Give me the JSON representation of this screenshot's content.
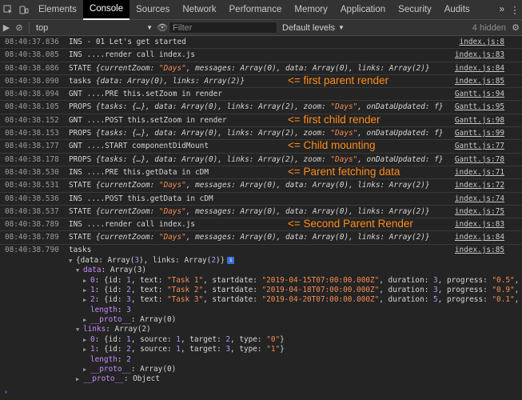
{
  "tabs": [
    "Elements",
    "Console",
    "Sources",
    "Network",
    "Performance",
    "Memory",
    "Application",
    "Security",
    "Audits"
  ],
  "toolbar": {
    "context": "top",
    "filter_placeholder": "Filter",
    "levels": "Default levels",
    "hidden": "4 hidden"
  },
  "logs": [
    {
      "ts": "08:40:37.836",
      "text": "INS - 01 Let's get started",
      "src": "index.js:8"
    },
    {
      "ts": "08:40:38.085",
      "text": "INS ....render call index.js",
      "src": "index.js:83"
    },
    {
      "ts": "08:40:38.086",
      "prefix": "STATE",
      "obj": "{currentZoom: \"Days\", messages: Array(0), data: Array(0), links: Array(2)}",
      "src": "index.js:84"
    },
    {
      "ts": "08:40:38.090",
      "text": "tasks",
      "obj": "{data: Array(0), links: Array(2)}",
      "src": "index.js:85",
      "ann": "<= first parent render"
    },
    {
      "ts": "08:40:38.094",
      "text": "GNT ....PRE this.setZoom in render",
      "src": "Gantt.js:94"
    },
    {
      "ts": "08:40:38.105",
      "prefix": "PROPS",
      "obj": "{tasks: {…}, data: Array(0), links: Array(2), zoom: \"Days\", onDataUpdated: f}",
      "src": "Gantt.js:95"
    },
    {
      "ts": "08:40:38.152",
      "text": "GNT ....POST this.setZoom in render",
      "src": "Gantt.js:98",
      "ann": "<= first child render"
    },
    {
      "ts": "08:40:38.153",
      "prefix": "PROPS",
      "obj": "{tasks: {…}, data: Array(0), links: Array(2), zoom: \"Days\", onDataUpdated: f}",
      "src": "Gantt.js:99"
    },
    {
      "ts": "08:40:38.177",
      "text": "GNT ....START componentDidMount",
      "src": "Gantt.js:77",
      "ann": "<= Child mounting"
    },
    {
      "ts": "08:40:38.178",
      "prefix": "PROPS",
      "obj": "{tasks: {…}, data: Array(0), links: Array(2), zoom: \"Days\", onDataUpdated: f}",
      "src": "Gantt.js:78"
    },
    {
      "ts": "08:40:38.530",
      "text": "INS ....PRE this.getData in cDM",
      "src": "index.js:71",
      "ann": "<= Parent fetching data"
    },
    {
      "ts": "08:40:38.531",
      "prefix": "STATE",
      "obj": "{currentZoom: \"Days\", messages: Array(0), data: Array(0), links: Array(2)}",
      "src": "index.js:72"
    },
    {
      "ts": "08:40:38.536",
      "text": "INS ....POST this.getData in cDM",
      "src": "index.js:74"
    },
    {
      "ts": "08:40:38.537",
      "prefix": "STATE",
      "obj": "{currentZoom: \"Days\", messages: Array(0), data: Array(0), links: Array(2)}",
      "src": "index.js:75"
    },
    {
      "ts": "08:40:38.789",
      "text": "INS ....render call index.js",
      "src": "index.js:83",
      "ann": "<= Second Parent Render"
    },
    {
      "ts": "08:40:38.789",
      "prefix": "STATE",
      "obj": "{currentZoom: \"Days\", messages: Array(0), data: Array(0), links: Array(2)}",
      "src": "index.js:84"
    }
  ],
  "expanded": {
    "ts": "08:40:38.790",
    "label": "tasks",
    "src": "index.js:85",
    "summary": "{data: Array(3), links: Array(2)}",
    "lines": [
      {
        "indent": 1,
        "tri": "▼",
        "k": "data",
        "v": ": Array(3)"
      },
      {
        "indent": 2,
        "tri": "▶",
        "k": "0",
        "v": ": {id: 1, text: \"Task 1\", startdate: \"2019-04-15T07:00:00.000Z\", duration: 3, progress: \"0.5\", …}"
      },
      {
        "indent": 2,
        "tri": "▶",
        "k": "1",
        "v": ": {id: 2, text: \"Task 2\", startdate: \"2019-04-18T07:00:00.000Z\", duration: 3, progress: \"0.9\", …}"
      },
      {
        "indent": 2,
        "tri": "▶",
        "k": "2",
        "v": ": {id: 3, text: \"Task 3\", startdate: \"2019-04-20T07:00:00.000Z\", duration: 5, progress: \"0.1\", …}"
      },
      {
        "indent": 2,
        "tri": "",
        "k": "length",
        "v": ": 3"
      },
      {
        "indent": 2,
        "tri": "▶",
        "k": "__proto__",
        "v": ": Array(0)"
      },
      {
        "indent": 1,
        "tri": "▼",
        "k": "links",
        "v": ": Array(2)"
      },
      {
        "indent": 2,
        "tri": "▶",
        "k": "0",
        "v": ": {id: 1, source: 1, target: 2, type: \"0\"}"
      },
      {
        "indent": 2,
        "tri": "▶",
        "k": "1",
        "v": ": {id: 2, source: 1, target: 3, type: \"1\"}"
      },
      {
        "indent": 2,
        "tri": "",
        "k": "length",
        "v": ": 2"
      },
      {
        "indent": 2,
        "tri": "▶",
        "k": "__proto__",
        "v": ": Array(0)"
      },
      {
        "indent": 1,
        "tri": "▶",
        "k": "__proto__",
        "v": ": Object"
      }
    ]
  },
  "prompt": "›"
}
